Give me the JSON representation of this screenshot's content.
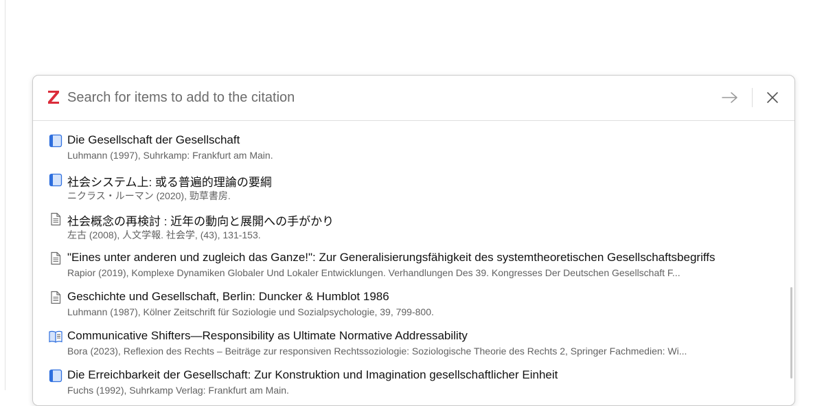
{
  "search": {
    "placeholder": "Search for items to add to the citation",
    "logo_letter": "Z"
  },
  "icons": {
    "brand": "zotero-z-logo",
    "submit": "arrow-right-icon",
    "close": "close-icon"
  },
  "colors": {
    "brand": "#db2c3a",
    "book_icon": "#2f6fde",
    "document_icon": "#6a6a6a"
  },
  "results": [
    {
      "type": "book",
      "title": "Die Gesellschaft der Gesellschaft",
      "subtitle": "Luhmann (1997), Suhrkamp: Frankfurt am Main."
    },
    {
      "type": "book",
      "title": "社会システム上: 或る普遍的理論の要綱",
      "subtitle": "ニクラス・ルーマン (2020), 勁草書房."
    },
    {
      "type": "journal-article",
      "title": "社会概念の再検討 : 近年の動向と展開への手がかり",
      "subtitle": "左古 (2008), 人文学報. 社会学, (43), 131-153."
    },
    {
      "type": "journal-article",
      "title": "\"Eines unter anderen und zugleich das Ganze!\": Zur Generalisierungsfähigkeit des systemtheoretischen Gesellschaftsbegriffs",
      "subtitle": "Rapior (2019), Komplexe Dynamiken Globaler Und Lokaler Entwicklungen. Verhandlungen Des 39. Kongresses Der Deutschen Gesellschaft F..."
    },
    {
      "type": "journal-article",
      "title": "Geschichte und Gesellschaft, Berlin: Duncker & Humblot 1986",
      "subtitle": "Luhmann (1987), Kölner Zeitschrift für Soziologie und Sozialpsychologie, 39, 799-800."
    },
    {
      "type": "book-section",
      "title": "Communicative Shifters—Responsibility as Ultimate Normative Addressability",
      "subtitle": "Bora (2023), Reflexion des Rechts – Beiträge zur responsiven Rechtssoziologie: Soziologische Theorie des Rechts 2, Springer Fachmedien: Wi..."
    },
    {
      "type": "book",
      "title": "Die Erreichbarkeit der Gesellschaft: Zur Konstruktion und Imagination gesellschaftlicher Einheit",
      "subtitle": "Fuchs (1992), Suhrkamp Verlag: Frankfurt am Main."
    }
  ]
}
